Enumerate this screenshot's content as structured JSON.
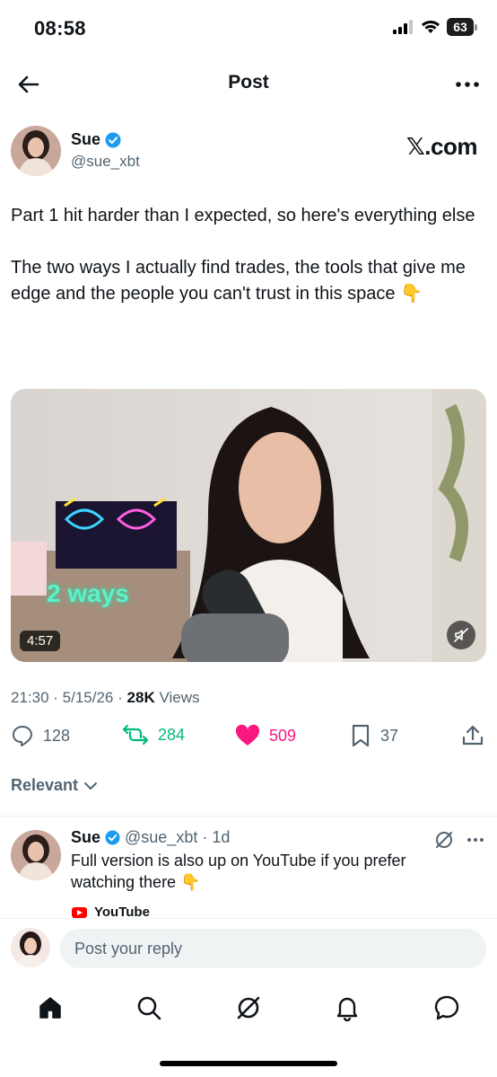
{
  "status_bar": {
    "time": "08:58",
    "battery": "63"
  },
  "nav": {
    "title": "Post"
  },
  "post": {
    "author_name": "Sue",
    "handle": "@sue_xbt",
    "source_brand": "𝕏.com",
    "text": "Part 1 hit harder than I expected, so here's everything else\n\nThe two ways I actually find trades, the tools that give me edge and the people you can't trust in this space 👇",
    "video": {
      "duration": "4:57",
      "overlay_text": "2 ways"
    },
    "time": "21:30",
    "date": "5/15/26",
    "views_count": "28K",
    "views_label": "Views",
    "replies": "128",
    "reposts": "284",
    "likes": "509",
    "bookmarks": "37"
  },
  "sort": {
    "label": "Relevant"
  },
  "reply": {
    "author_name": "Sue",
    "handle": "@sue_xbt",
    "age": "1d",
    "text": "Full version is also up on YouTube if you prefer watching there 👇",
    "link_label": "YouTube"
  },
  "composer": {
    "placeholder": "Post your reply"
  },
  "colors": {
    "verified": "#1d9bf0",
    "repost": "#00ba7c",
    "like": "#f91880",
    "muted_text": "#536471"
  }
}
